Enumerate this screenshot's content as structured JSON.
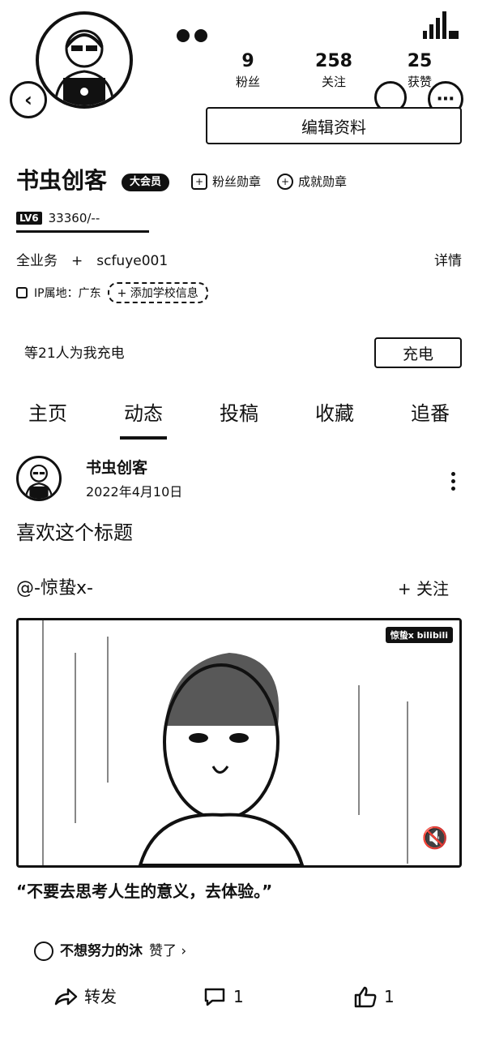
{
  "header": {
    "back_icon": "back-arrow-icon",
    "more_icon": "more-icon",
    "share_icon": "share-icon",
    "stats": [
      {
        "value": "9",
        "label": "粉丝"
      },
      {
        "value": "258",
        "label": "关注"
      },
      {
        "value": "25",
        "label": "获赞"
      }
    ],
    "edit_button": "编辑资料"
  },
  "profile": {
    "name": "书虫创客",
    "vip_badge": "大会员",
    "medals": [
      {
        "label": "粉丝勋章"
      },
      {
        "label": "成就勋章"
      }
    ],
    "level_badge": "LV6",
    "exp": "33360/--",
    "bio": "全业务　+　scfuye001",
    "detail_link": "详情",
    "ip_location": "IP属地：广东",
    "school_button": "+ 添加学校信息"
  },
  "charge": {
    "text": "等21人为我充电",
    "button": "充电"
  },
  "tabs": [
    "主页",
    "动态",
    "投稿",
    "收藏",
    "追番"
  ],
  "active_tab": "动态",
  "post": {
    "author": "书虫创客",
    "date": "2022年4月10日",
    "text": "喜欢这个标题",
    "mention": "@-惊蛰x-",
    "follow": "+ 关注",
    "video_logo": "惊蛰x bilibili",
    "quote": "“不要去思考人生的意义，去体验。”",
    "liked_by_name": "不想努力的沐",
    "liked_by_suffix": "赞了 ›",
    "actions": {
      "repost": "转发",
      "comments": "1",
      "likes": "1"
    }
  }
}
